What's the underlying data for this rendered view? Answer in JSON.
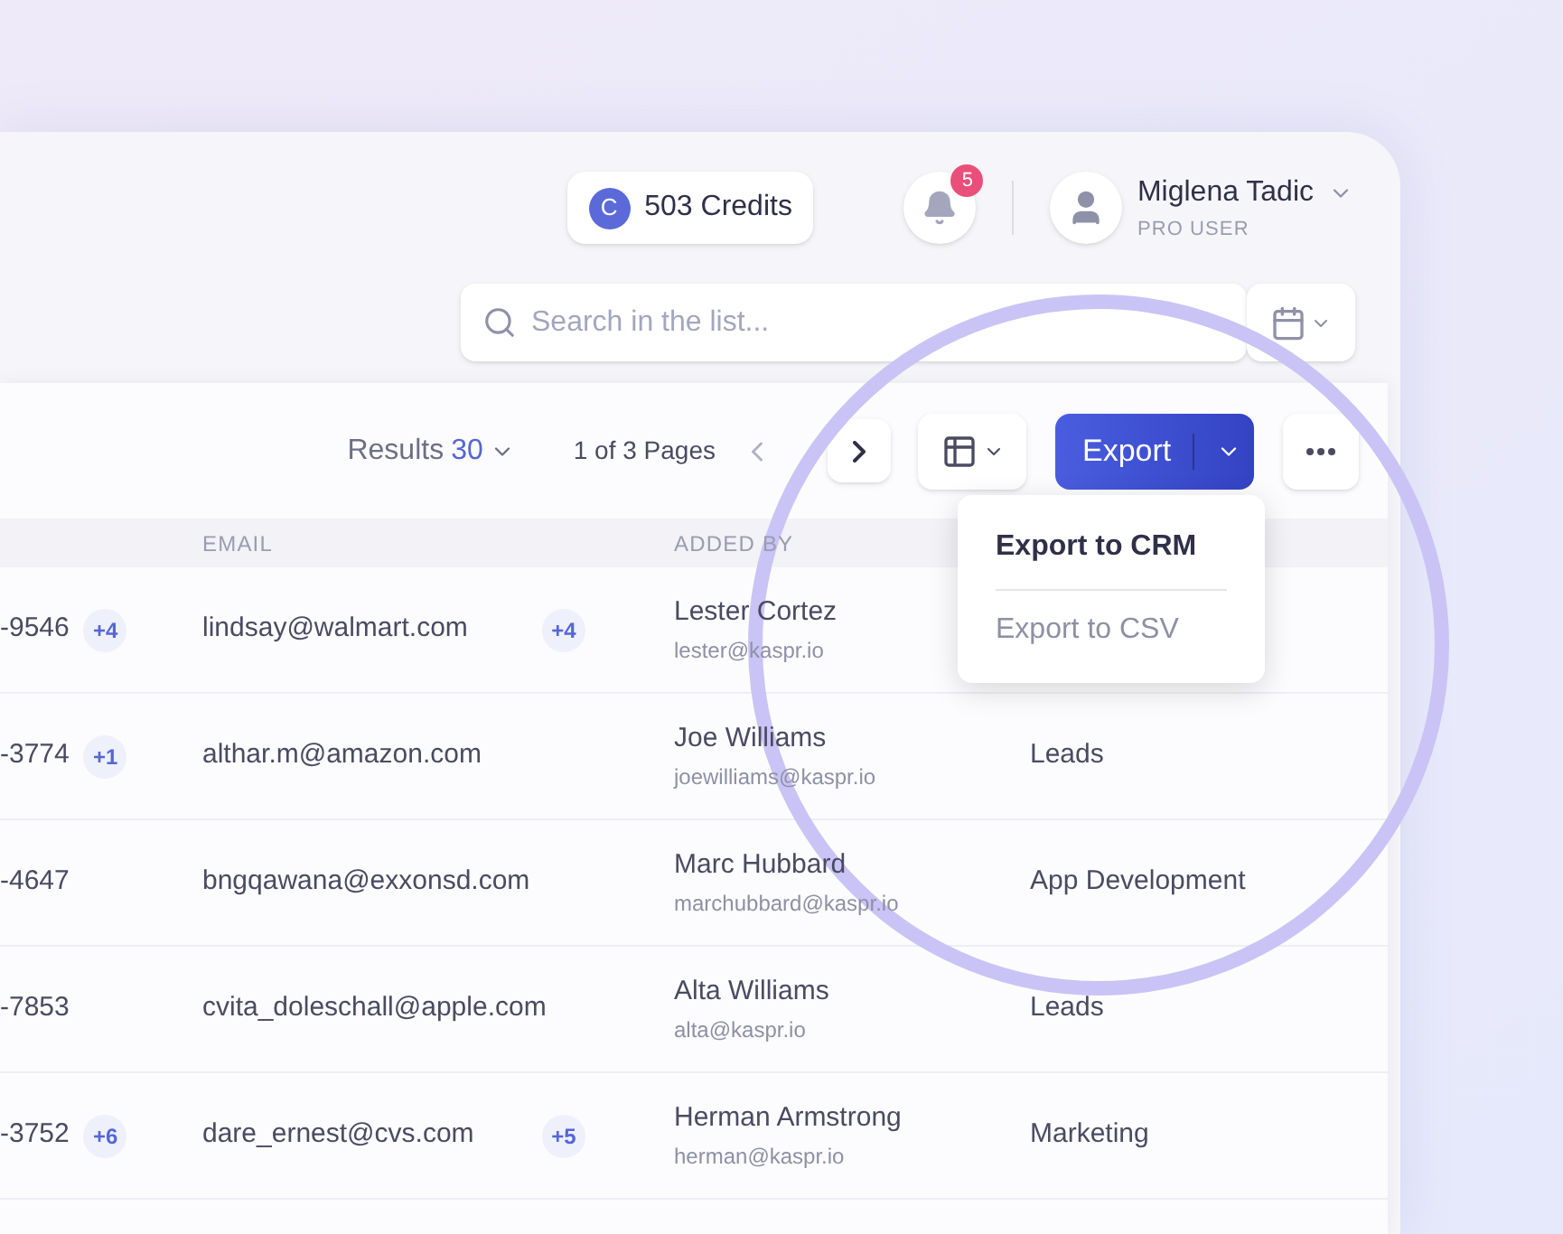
{
  "header": {
    "credits": {
      "icon_letter": "C",
      "label": "503 Credits"
    },
    "notifications": {
      "count": "5"
    },
    "user": {
      "name": "Miglena Tadic",
      "role": "PRO USER"
    }
  },
  "search": {
    "placeholder": "Search in the list..."
  },
  "toolbar": {
    "results_label": "Results",
    "results_count": "30",
    "pages": "1 of 3 Pages",
    "export_label": "Export",
    "export_menu": [
      {
        "label": "Export to CRM",
        "selected": true
      },
      {
        "label": "Export to CSV",
        "selected": false
      }
    ]
  },
  "table": {
    "columns": [
      "EMAIL",
      "ADDED BY"
    ],
    "rows": [
      {
        "phone": "-9546",
        "phone_extra": "+4",
        "email": "lindsay@walmart.com",
        "email_extra": "+4",
        "added_by": "Lester Cortez",
        "added_by_email": "lester@kaspr.io"
      },
      {
        "phone": "-3774",
        "phone_extra": "+1",
        "email": "althar.m@amazon.com",
        "added_by": "Joe Williams",
        "added_by_email": "joewilliams@kaspr.io",
        "list": "Leads"
      },
      {
        "phone": "-4647",
        "email": "bngqawana@exxonsd.com",
        "added_by": "Marc Hubbard",
        "added_by_email": "marchubbard@kaspr.io",
        "list": "App Development"
      },
      {
        "phone": "-7853",
        "email": "cvita_doleschall@apple.com",
        "added_by": "Alta Williams",
        "added_by_email": "alta@kaspr.io",
        "list": "Leads"
      },
      {
        "phone": "-3752",
        "phone_extra": "+6",
        "email": "dare_ernest@cvs.com",
        "email_extra": "+5",
        "added_by": "Herman Armstrong",
        "added_by_email": "herman@kaspr.io",
        "list": "Marketing"
      }
    ]
  }
}
